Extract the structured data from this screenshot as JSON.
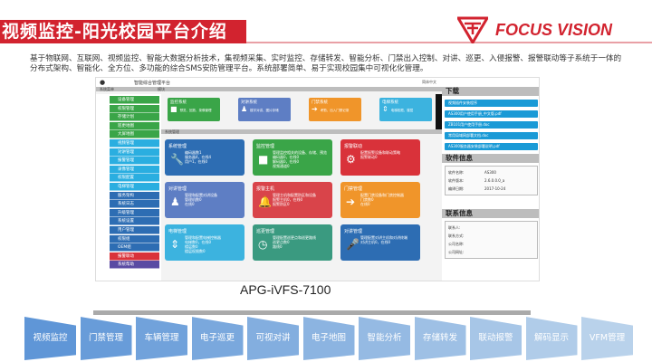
{
  "title": "视频监控-阳光校园平台介绍",
  "brand": {
    "name": "FOCUS VISION",
    "color": "#d2232f"
  },
  "intro": "基于物联网、互联网、视频监控、智能大数据分析技术，集视频采集、实时监控、存储转发、智能分析、门禁出入控制、对讲、巡更、入侵报警、报警联动等子系统于一体的分布式架构、智能化、全方位、多功能的综合SMS安防管理平台。系统部署简单、易于实现校园集中可视化化管理。",
  "screenshot": {
    "app_title": "智能综合管理平台",
    "menu_header": "系统菜单",
    "module_header": "模块",
    "system_header": "系统管理",
    "sidebar": [
      {
        "label": "设备管理",
        "color": "#3aa548"
      },
      {
        "label": "权限管理",
        "color": "#3aa548"
      },
      {
        "label": "存储计划",
        "color": "#3aa548"
      },
      {
        "label": "巡更地图",
        "color": "#3aa548"
      },
      {
        "label": "大屏地图",
        "color": "#3aa548"
      },
      {
        "label": "视频管理",
        "color": "#2aaee0"
      },
      {
        "label": "对讲管理",
        "color": "#2aaee0"
      },
      {
        "label": "报警管理",
        "color": "#2aaee0"
      },
      {
        "label": "录像管理",
        "color": "#2aaee0"
      },
      {
        "label": "权限配置",
        "color": "#2aaee0"
      },
      {
        "label": "电梯管理",
        "color": "#2aaee0"
      },
      {
        "label": "服务架构",
        "color": "#2d6db3"
      },
      {
        "label": "系统日志",
        "color": "#2d6db3"
      },
      {
        "label": "升级管理",
        "color": "#2d6db3"
      },
      {
        "label": "系统设置",
        "color": "#2d6db3"
      },
      {
        "label": "用户管理",
        "color": "#2d6db3"
      },
      {
        "label": "权限组",
        "color": "#2d6db3"
      },
      {
        "label": "OEM组",
        "color": "#2d6db3"
      },
      {
        "label": "报警联动",
        "color": "#d9323a"
      },
      {
        "label": "系统帮助",
        "color": "#5a4ba3"
      }
    ],
    "modules": [
      {
        "label": "监控系统",
        "desc": "预览、回放、录像管理",
        "icon": "■",
        "color": "#3aa548"
      },
      {
        "label": "对讲系统",
        "desc": "楼宇对讲、图片存储",
        "icon": "♟",
        "color": "#5e7ec4"
      },
      {
        "label": "门禁系统",
        "desc": "考勤、出入门禁记录",
        "icon": "➔",
        "color": "#f0952a"
      },
      {
        "label": "电梯系统",
        "desc": "电梯权限、楼层",
        "icon": "⇕",
        "color": "#3cb3df"
      }
    ],
    "tiles": [
      {
        "title": "系统管理",
        "icon": "🔧",
        "lines": [
          "编码器数1",
          "服务器4，在线4",
          "用户1，在线0"
        ],
        "color": "#2d6db3"
      },
      {
        "title": "监控管理",
        "icon": "■",
        "lines": [
          "管理监控相关的设备、存储、预览",
          "编码器0，在线0",
          "解码器0，在线0",
          "视频通道0"
        ],
        "color": "#3aa548"
      },
      {
        "title": "报警联动",
        "icon": "⚙",
        "lines": [
          "配置报警设备和联动策略",
          "报警联动0"
        ],
        "color": "#d9323a"
      },
      {
        "title": "对讲管理",
        "icon": "♟",
        "lines": [
          "管理和配置对讲设备",
          "管理机数0",
          "在线0"
        ],
        "color": "#5e7ec4"
      },
      {
        "title": "报警主机",
        "icon": "🔔",
        "lines": [
          "管理主机和配置防区和设备",
          "报警主机0，在线0",
          "报警防区0"
        ],
        "color": "#d9444a"
      },
      {
        "title": "门禁管理",
        "icon": "➔",
        "lines": [
          "配置门禁设备和门禁控制器",
          "门禁数0",
          "在线0"
        ],
        "color": "#f0952a"
      },
      {
        "title": "电梯管理",
        "icon": "⇕",
        "lines": [
          "管理和配置电梯控制器",
          "电梯数0，在线0",
          "楼层数0",
          "楼层权限数0"
        ],
        "color": "#3cb3df"
      },
      {
        "title": "巡更管理",
        "icon": "◷",
        "lines": [
          "管理配置巡更点和巡更路线",
          "巡更点数0",
          "路线0"
        ],
        "color": "#3a9a80"
      },
      {
        "title": "对讲管理",
        "icon": "🎤",
        "lines": [
          "管理配置对讲主机和对讲终端",
          "对讲主机0，在线0"
        ],
        "color": "#2d6db3"
      }
    ],
    "downloads_header": "下载",
    "downloads": [
      "视频插件安装程序",
      "AS300用户使用手册_中文版.pdf",
      "ZB101用户使用手册.doc",
      "常用局域网部署文档.doc",
      "AS300服务器安装部署说明.pdf"
    ],
    "software_header": "软件信息",
    "software": [
      {
        "k": "软件名称:",
        "v": "AS300"
      },
      {
        "k": "软件版本:",
        "v": "2.6.0.0.0_a"
      },
      {
        "k": "编译日期:",
        "v": "2017-10-24"
      }
    ],
    "contact_header": "联系信息",
    "contact": [
      "联系人:",
      "联系方式:",
      "公司名称:",
      "公司网址:"
    ],
    "lang_label": "简体中文"
  },
  "model": "APG-iVFS-7100",
  "features": [
    "视频监控",
    "门禁管理",
    "车辆管理",
    "电子巡更",
    "可视对讲",
    "电子地图",
    "智能分析",
    "存储转发",
    "联动报警",
    "解码显示",
    "VFM管理"
  ]
}
